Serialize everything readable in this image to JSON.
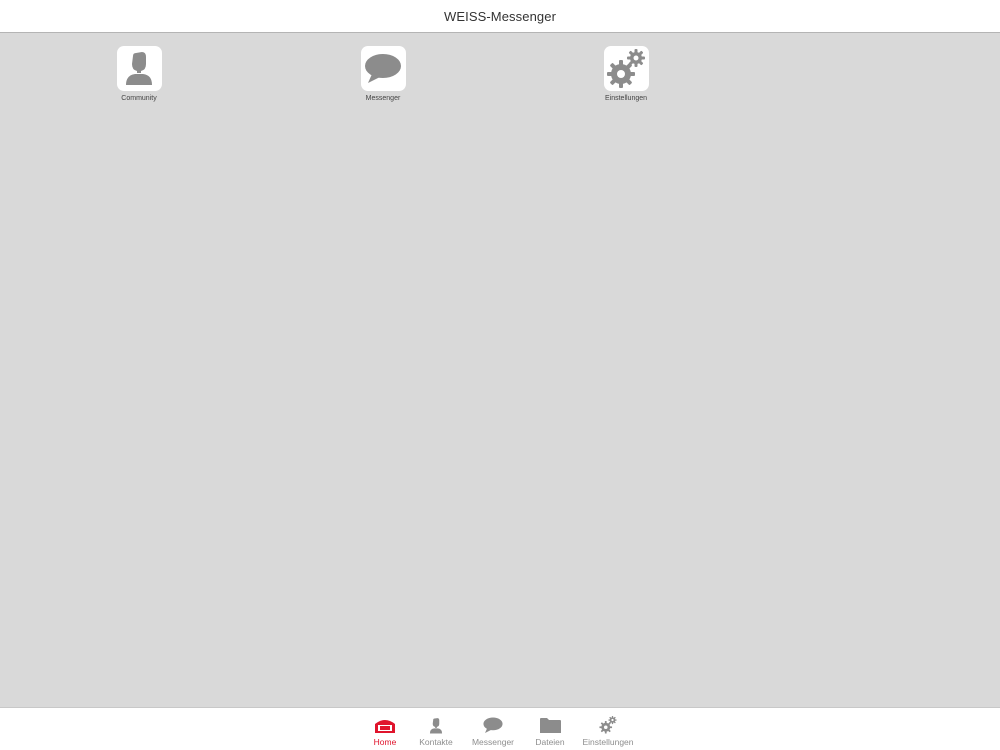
{
  "header": {
    "title": "WEISS-Messenger"
  },
  "tiles": [
    {
      "label": "Community",
      "icon": "person-icon"
    },
    {
      "label": "Messenger",
      "icon": "speech-bubble-icon"
    },
    {
      "label": "Einstellungen",
      "icon": "gears-icon"
    }
  ],
  "tabbar": {
    "items": [
      {
        "label": "Home",
        "icon": "home-icon",
        "active": true
      },
      {
        "label": "Kontakte",
        "icon": "person-icon",
        "active": false
      },
      {
        "label": "Messenger",
        "icon": "speech-bubble-icon",
        "active": false
      },
      {
        "label": "Dateien",
        "icon": "folder-icon",
        "active": false
      },
      {
        "label": "Einstellungen",
        "icon": "gears-icon",
        "active": false
      }
    ]
  },
  "colors": {
    "background": "#d9d9d9",
    "icon_gray": "#8c8c8c",
    "accent_red": "#e0142c",
    "inactive_label": "#8e8e8e"
  }
}
